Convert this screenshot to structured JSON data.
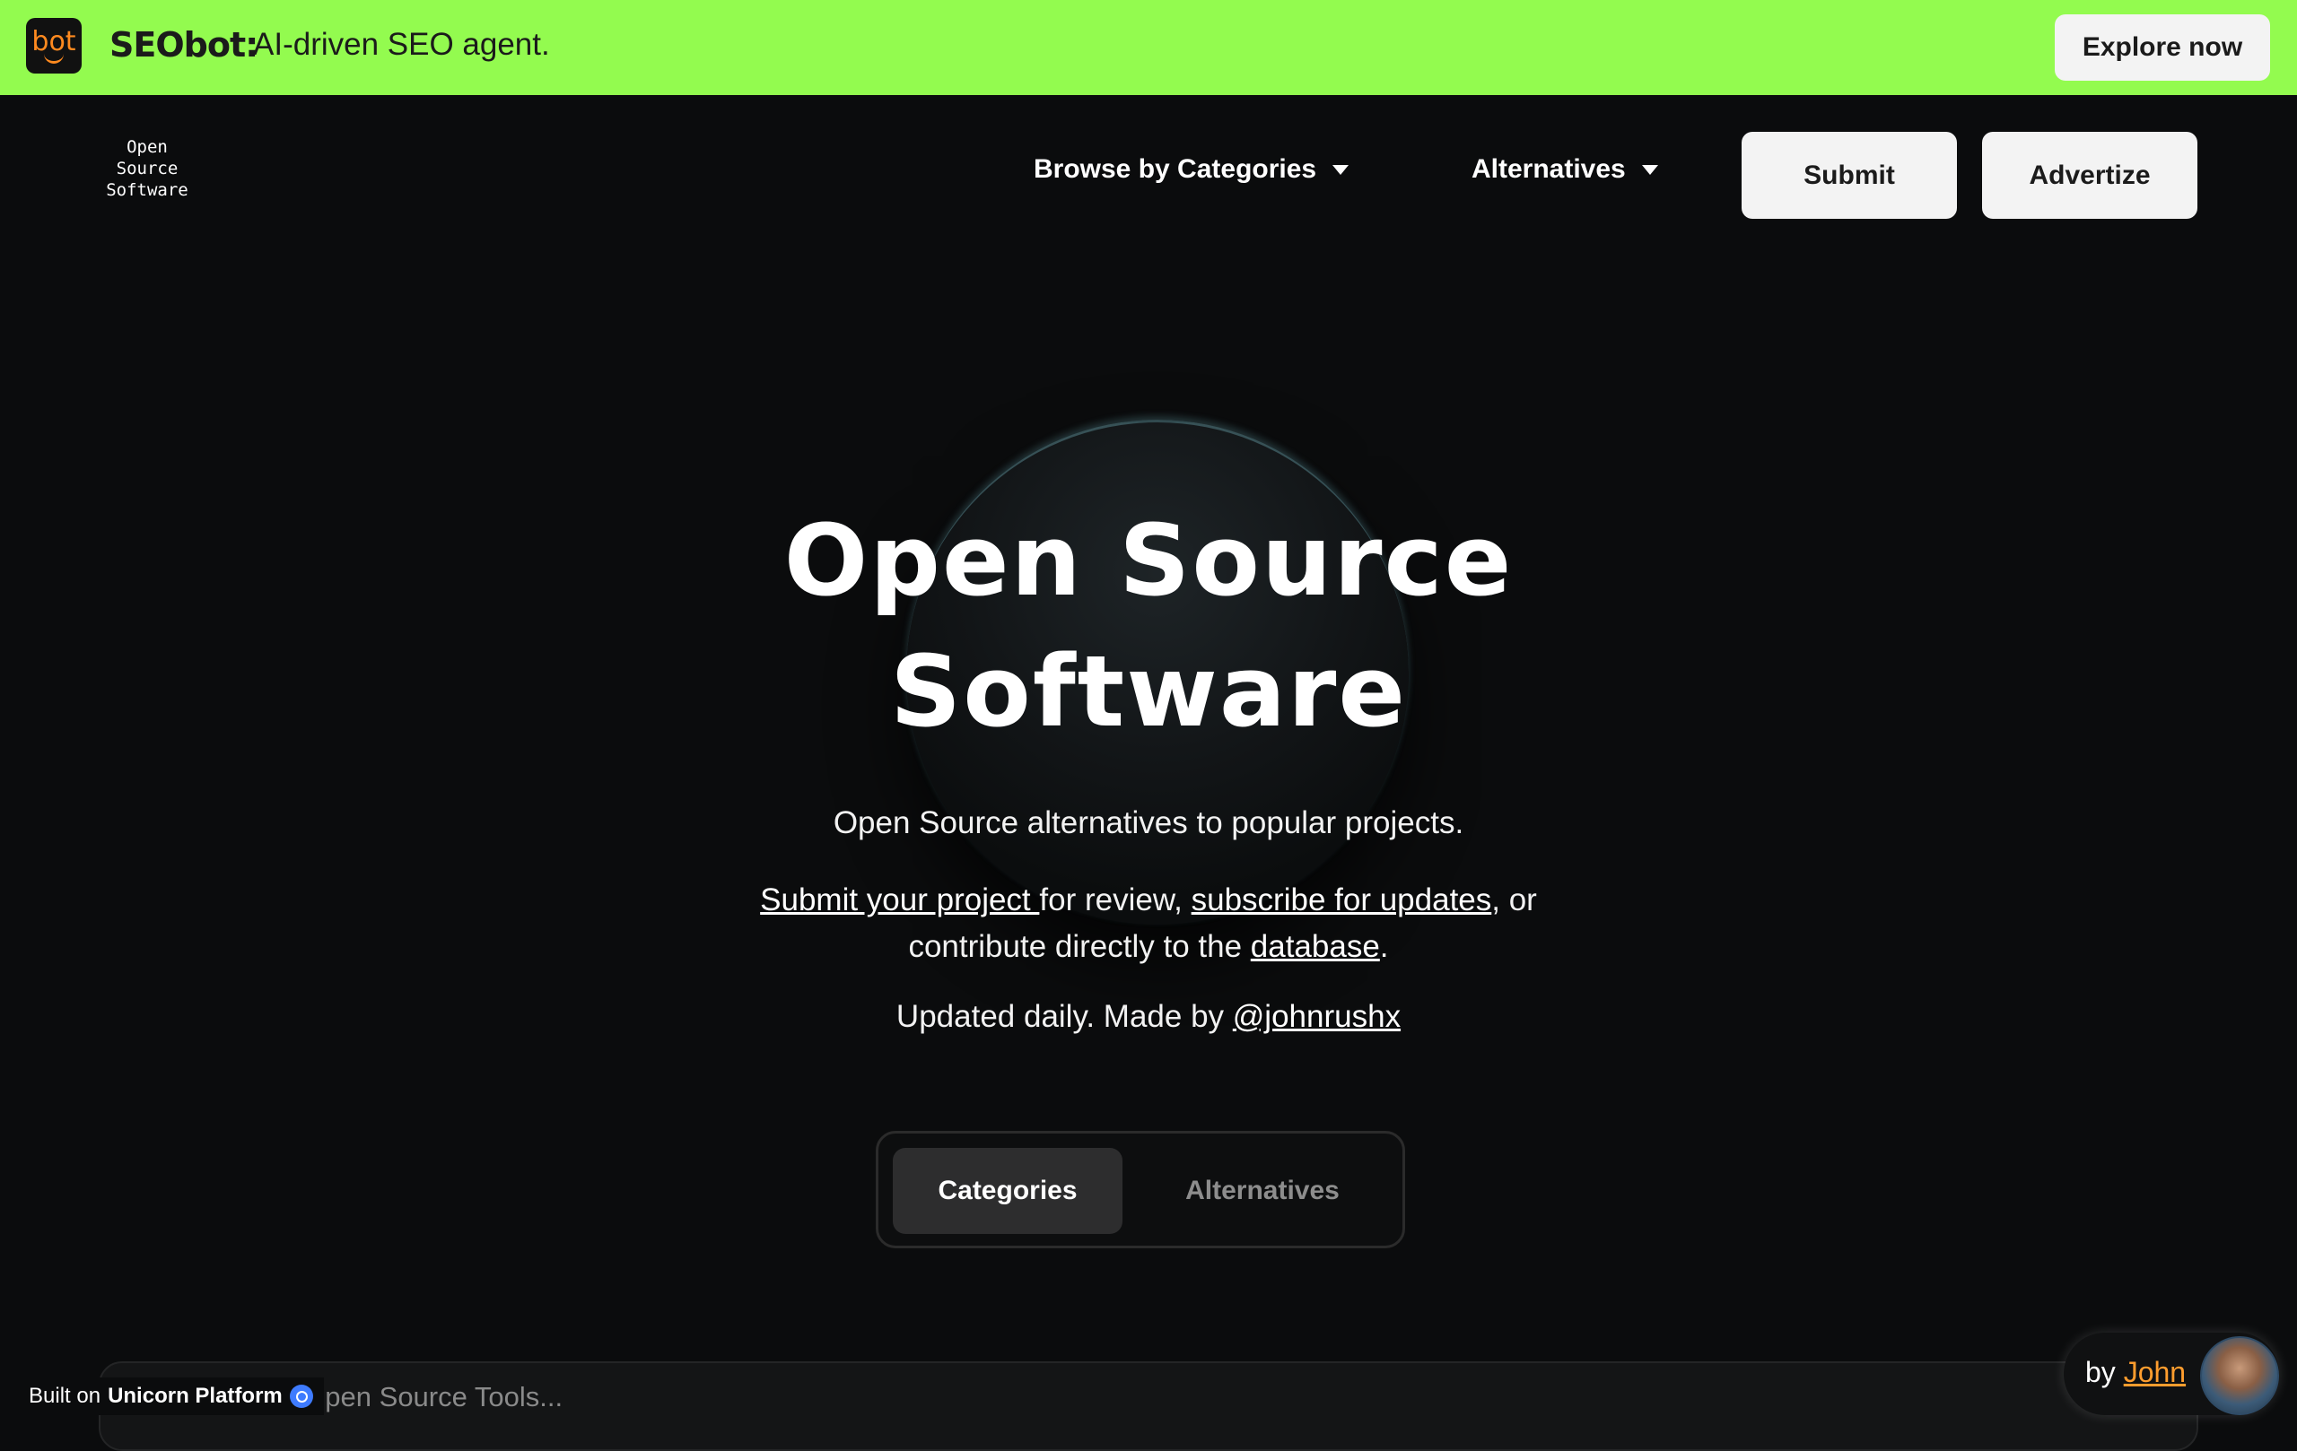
{
  "banner": {
    "logo_text": "bot",
    "brand": "SEObot:",
    "tagline": "AI-driven SEO agent.",
    "cta": "Explore now",
    "bg_color": "#93fb4f"
  },
  "nav": {
    "logo_lines": [
      "Open",
      "Source",
      "Software"
    ],
    "browse_label": "Browse by Categories",
    "alternatives_label": "Alternatives",
    "submit_label": "Submit",
    "advertize_label": "Advertize"
  },
  "hero": {
    "title_line1": "Open Source",
    "title_line2": "Software",
    "subtitle": "Open Source alternatives to popular projects.",
    "p_link1": "Submit your project ",
    "p_text1": "for review, ",
    "p_link2": "subscribe for updates",
    "p_text2": ", or contribute directly to the ",
    "p_link3": "database",
    "p_text3": ".",
    "updated_text": "Updated daily. Made by ",
    "updated_link": "@johnrushx"
  },
  "toggle": {
    "active": "Categories",
    "inactive": "Alternatives"
  },
  "search": {
    "placeholder": "g 903 Open Source Tools..."
  },
  "footer": {
    "built_on": "Built on",
    "platform": "Unicorn Platform",
    "by": "by ",
    "author": "John"
  }
}
